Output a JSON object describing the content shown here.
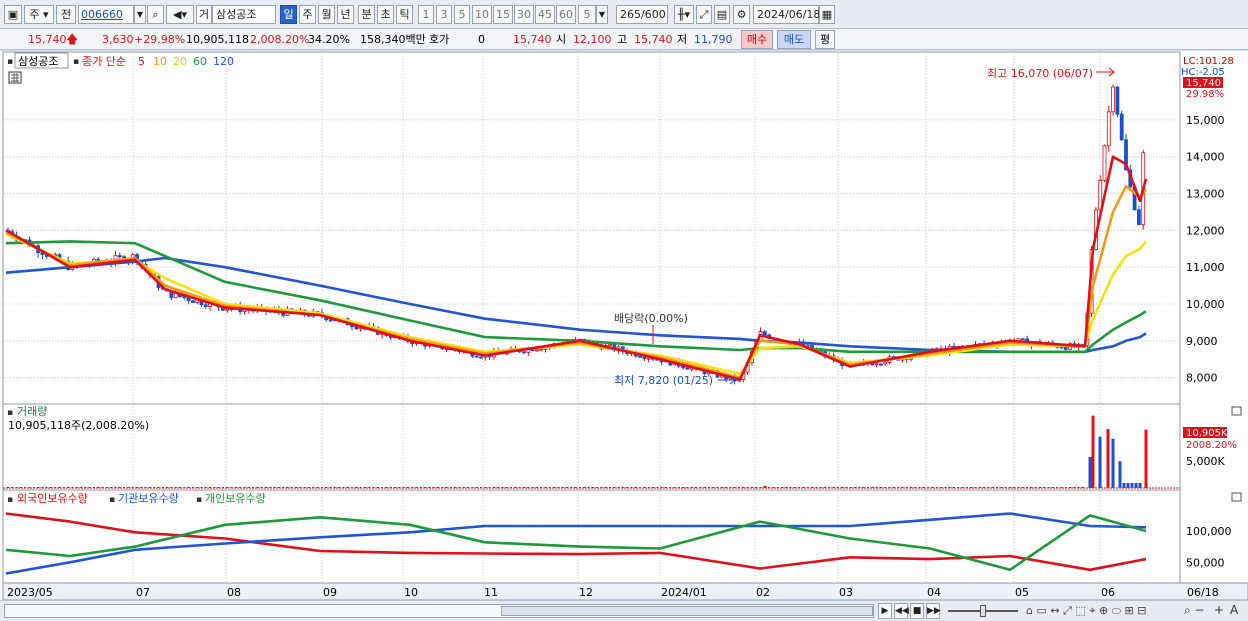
{
  "toolbar": {
    "market_label": "주",
    "prev_label": "전",
    "code": "006660",
    "stock_name": "삼성공조",
    "exchange_label": "거",
    "periods": [
      "일",
      "주",
      "월",
      "년",
      "분",
      "초",
      "틱"
    ],
    "selected_period": "일",
    "intervals": [
      "1",
      "3",
      "5",
      "10",
      "15",
      "30",
      "45",
      "60"
    ],
    "interval_value": "5",
    "count": "265",
    "count_max": "/600",
    "date": "2024/06/18"
  },
  "quote": {
    "price": "15,740",
    "change": "3,630",
    "change_pct": "+29.98%",
    "volume": "10,905,118",
    "volume_pct": "2,008.20%",
    "turnover_pct": "34.20%",
    "trade_value": "158,340백만",
    "hoga_label": "호가",
    "hoga_value": "0",
    "hoga_price": "15,740",
    "open_label": "시",
    "open": "12,100",
    "high_label": "고",
    "high": "15,740",
    "low_label": "저",
    "low": "11,790",
    "buy_label": "매수",
    "sell_label": "매도",
    "avg_label": "평"
  },
  "price_pane": {
    "stock_label": "삼성공조",
    "ma_label": "종가 단순",
    "ma_periods": [
      "5",
      "10",
      "20",
      "60",
      "120"
    ],
    "ma_colors": [
      "#e0101a",
      "#f59a15",
      "#f4e213",
      "#1f9a3a",
      "#2255d6"
    ],
    "lc": "LC:101.28",
    "hc": "HC:-2.05",
    "last_price_tag": "15,740",
    "last_pct_tag": "29.98%",
    "high_annot": "최고 16,070 (06/07)",
    "low_annot": "최저 7,820 (01/25)",
    "dividend_annot": "배당락(0.00%)",
    "y_ticks": [
      "15,000",
      "14,000",
      "13,000",
      "12,000",
      "11,000",
      "10,000",
      "9,000",
      "8,000"
    ]
  },
  "volume_pane": {
    "title": "거래량",
    "value_text": "10,905,118주(2,008.20%)",
    "tag_value": "10,905K",
    "tag_pct": "2008.20%",
    "y_tick": "5,000K"
  },
  "holdings_pane": {
    "series": [
      "외국인보유수량",
      "기관보유수량",
      "개인보유수량"
    ],
    "colors": [
      "#e0101a",
      "#2255d6",
      "#1f9a3a"
    ],
    "y_ticks": [
      "100,000",
      "50,000"
    ]
  },
  "x_axis": {
    "labels": [
      "2023/05",
      "07",
      "08",
      "09",
      "10",
      "11",
      "12",
      "2024/01",
      "02",
      "03",
      "04",
      "05",
      "06",
      "06/18"
    ]
  },
  "chart_data": {
    "type": "line",
    "price_axis": {
      "ylim": [
        7500,
        16600
      ]
    },
    "close_series": {
      "name": "종가",
      "x": [
        "2023/05",
        "2023/06",
        "2023/07",
        "2023/07-mid",
        "2023/08",
        "2023/09",
        "2023/10",
        "2023/11",
        "2023/12",
        "2024/01",
        "2024/01/25",
        "2024/02",
        "2024/02-mid",
        "2024/03",
        "2024/04",
        "2024/05",
        "2024/05-end",
        "2024/06/03",
        "2024/06/07",
        "2024/06/12",
        "2024/06/17",
        "2024/06/18"
      ],
      "values": [
        12000,
        11000,
        11300,
        10300,
        9900,
        9700,
        9000,
        8600,
        9000,
        8500,
        7900,
        9200,
        8900,
        8300,
        8700,
        9000,
        8800,
        12000,
        16070,
        13600,
        12100,
        15740
      ]
    },
    "series": [
      {
        "name": "5",
        "values": [
          12000,
          11000,
          11200,
          10400,
          9900,
          9700,
          9000,
          8600,
          9000,
          8500,
          7950,
          9150,
          8900,
          8300,
          8700,
          9000,
          8850,
          11500,
          14000,
          13800,
          12800,
          13400
        ]
      },
      {
        "name": "10",
        "values": [
          11950,
          11050,
          11250,
          10500,
          9950,
          9700,
          9050,
          8650,
          8950,
          8550,
          8000,
          9000,
          8900,
          8350,
          8650,
          8950,
          8850,
          10500,
          12500,
          13200,
          12900,
          13100
        ]
      },
      {
        "name": "20",
        "values": [
          11900,
          11100,
          11200,
          10700,
          10000,
          9750,
          9100,
          8700,
          8900,
          8600,
          8100,
          8800,
          8850,
          8400,
          8600,
          8900,
          8850,
          9600,
          10800,
          11300,
          11500,
          11700
        ]
      },
      {
        "name": "60",
        "values": [
          11650,
          11700,
          11650,
          11300,
          10600,
          10100,
          9550,
          9100,
          9000,
          8850,
          8750,
          8800,
          8800,
          8700,
          8700,
          8700,
          8700,
          8900,
          9300,
          9500,
          9700,
          9800
        ]
      },
      {
        "name": "120",
        "values": [
          10850,
          11000,
          11150,
          11250,
          11000,
          10500,
          10000,
          9600,
          9300,
          9150,
          9050,
          9000,
          8950,
          8850,
          8750,
          8700,
          8700,
          8750,
          8850,
          9000,
          9100,
          9200
        ]
      }
    ],
    "volume": {
      "x": [
        "2024/02/01",
        "2024/06/03",
        "2024/06/04",
        "2024/06/05",
        "2024/06/07",
        "2024/06/10",
        "2024/06/12",
        "2024/06/18"
      ],
      "values": [
        400000,
        5800000,
        13500000,
        9600000,
        11000000,
        9200000,
        5000000,
        10905118
      ],
      "ylim": [
        0,
        14000000
      ]
    },
    "holdings": {
      "ylim": [
        20000,
        140000
      ],
      "x": [
        "2023/05",
        "2023/06",
        "2023/07",
        "2023/08",
        "2023/09",
        "2023/10",
        "2023/11",
        "2023/12",
        "2024/01",
        "2024/02",
        "2024/03",
        "2024/04",
        "2024/05",
        "2024/06",
        "2024/06/18"
      ],
      "series": [
        {
          "name": "외국인보유수량",
          "values": [
            128000,
            115000,
            98000,
            88000,
            68000,
            65000,
            64000,
            63000,
            65000,
            40000,
            58000,
            55000,
            60000,
            38000,
            55000
          ]
        },
        {
          "name": "기관보유수량",
          "values": [
            32000,
            50000,
            70000,
            80000,
            90000,
            98000,
            108000,
            108000,
            108000,
            108000,
            108000,
            118000,
            128000,
            108000,
            106000
          ]
        },
        {
          "name": "개인보유수량",
          "values": [
            70000,
            60000,
            75000,
            110000,
            122000,
            110000,
            82000,
            75000,
            72000,
            115000,
            88000,
            72000,
            38000,
            125000,
            100000
          ]
        }
      ]
    }
  }
}
